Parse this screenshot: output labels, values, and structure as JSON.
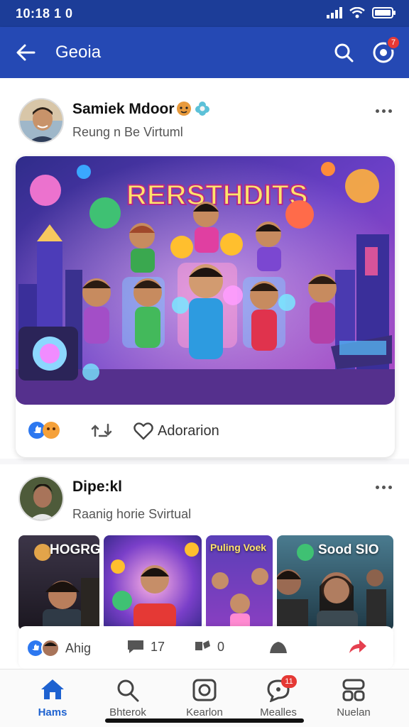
{
  "status_bar": {
    "time": "10:18 1 0",
    "icons": [
      "signal-icon",
      "wifi-icon",
      "battery-icon"
    ]
  },
  "app_bar": {
    "title": "Geoia",
    "back_icon": "arrow-left-icon",
    "search_icon": "search-icon",
    "notification_icon": "notification-icon",
    "notification_count": "7"
  },
  "posts": [
    {
      "author": "Samiek Mdoor",
      "subtitle": "Reung n Be Virtuml",
      "hero_title": "RERSTHDITS",
      "reaction_action": "Adorarion"
    },
    {
      "author": "Dipe:kl",
      "subtitle": "Raanig horie Svirtual",
      "thumbnails": [
        "HOGRGE",
        "",
        "Puling Voek",
        "Sood SIO"
      ],
      "reaction_name": "Ahig",
      "comments": "17",
      "shares": "0"
    }
  ],
  "bottom_nav": [
    {
      "label": "Hams",
      "icon": "home-icon",
      "active": true
    },
    {
      "label": "Bhterok",
      "icon": "search-icon",
      "active": false
    },
    {
      "label": "Kearlon",
      "icon": "camera-icon",
      "active": false
    },
    {
      "label": "Mealles",
      "icon": "message-icon",
      "active": false,
      "badge": "11"
    },
    {
      "label": "Nuelan",
      "icon": "grid-icon",
      "active": false
    }
  ],
  "colors": {
    "app_bar": "#2549b4",
    "status_bar": "#1c3d98",
    "active_nav": "#1e62d0",
    "badge": "#e53935"
  }
}
